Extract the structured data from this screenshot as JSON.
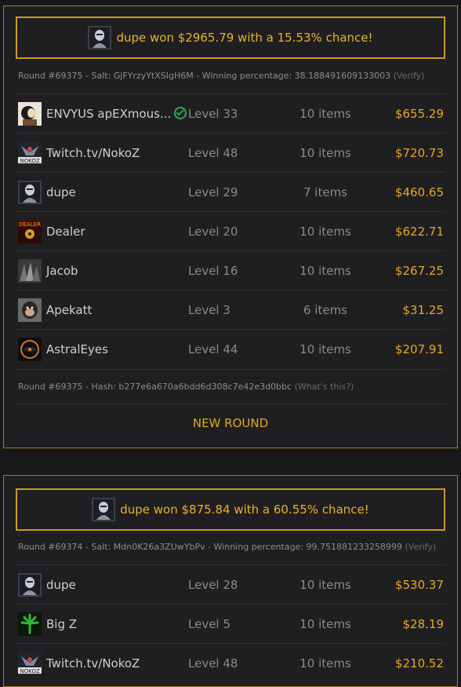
{
  "rounds": [
    {
      "winner_text": "dupe won $2965.79 with a 15.53% chance!",
      "salt_line": "Round #69375 - Salt: GjFYrzyYtXSIgH6M - Winning percentage: 38.188491609133003 ",
      "verify_label": "(Verify)",
      "players": [
        {
          "name": "ENVYUS apEXmous...",
          "verified": true,
          "level": "Level 33",
          "items": "10 items",
          "value": "$655.29",
          "avatar": "cartoon-avatar"
        },
        {
          "name": "Twitch.tv/NokoZ",
          "verified": false,
          "level": "Level 48",
          "items": "10 items",
          "value": "$720.73",
          "avatar": "nokoz-avatar"
        },
        {
          "name": "dupe",
          "verified": false,
          "level": "Level 29",
          "items": "7 items",
          "value": "$460.65",
          "avatar": "dupe-avatar"
        },
        {
          "name": "Dealer",
          "verified": false,
          "level": "Level 20",
          "items": "10 items",
          "value": "$622.71",
          "avatar": "dealer-avatar"
        },
        {
          "name": "Jacob",
          "verified": false,
          "level": "Level 16",
          "items": "10 items",
          "value": "$267.25",
          "avatar": "jacob-avatar"
        },
        {
          "name": "Apekatt",
          "verified": false,
          "level": "Level 3",
          "items": "6 items",
          "value": "$31.25",
          "avatar": "ape-avatar"
        },
        {
          "name": "AstralEyes",
          "verified": false,
          "level": "Level 44",
          "items": "10 items",
          "value": "$207.91",
          "avatar": "eye-avatar"
        }
      ],
      "hash_line": "Round #69375 - Hash: b277e6a670a6bdd6d308c7e42e3d0bbc ",
      "whats_this_label": "(What's this?)",
      "new_round_label": "NEW ROUND"
    },
    {
      "winner_text": "dupe won $875.84 with a 60.55% chance!",
      "salt_line": "Round #69374 - Salt: Mdn0K26a3ZUwYbPv - Winning percentage: 99.751881233258999 ",
      "verify_label": "(Verify)",
      "players": [
        {
          "name": "dupe",
          "verified": false,
          "level": "Level 28",
          "items": "10 items",
          "value": "$530.37",
          "avatar": "dupe-avatar"
        },
        {
          "name": "Big Z",
          "verified": false,
          "level": "Level 5",
          "items": "10 items",
          "value": "$28.19",
          "avatar": "leaf-avatar"
        },
        {
          "name": "Twitch.tv/NokoZ",
          "verified": false,
          "level": "Level 48",
          "items": "10 items",
          "value": "$210.52",
          "avatar": "nokoz-avatar"
        }
      ]
    }
  ],
  "colors": {
    "accent": "#e5a91e",
    "border": "#a07e1a",
    "background": "#18181a",
    "panel": "#1f1f21",
    "verified": "#2fa84f"
  }
}
